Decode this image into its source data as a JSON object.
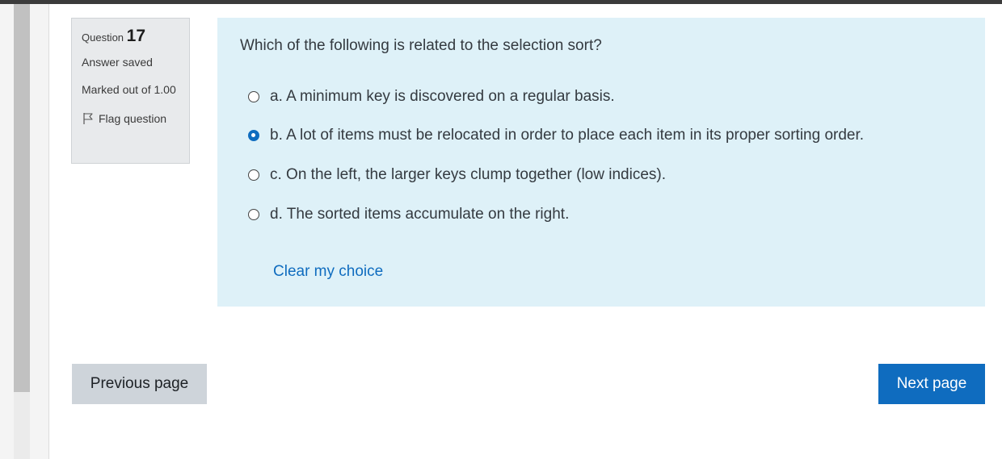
{
  "question": {
    "label": "Question",
    "number": "17",
    "state": "Answer saved",
    "grade": "Marked out of 1.00",
    "flag_label": "Flag question",
    "text": "Which of the following is related to the selection sort?",
    "answers": [
      {
        "text": "a. A minimum key is discovered on a regular basis.",
        "selected": false
      },
      {
        "text": "b. A lot of items must be relocated in order to place each item in its proper sorting order.",
        "selected": true
      },
      {
        "text": "c. On the left, the larger keys clump together (low indices).",
        "selected": false
      },
      {
        "text": "d. The sorted items accumulate on the right.",
        "selected": false
      }
    ],
    "clear_label": "Clear my choice"
  },
  "navigation": {
    "prev_label": "Previous page",
    "next_label": "Next page"
  },
  "colors": {
    "accent": "#0f6cbf",
    "content_bg": "#def1f8",
    "info_bg": "#e8eaec"
  },
  "icons": {
    "flag": "flag-icon"
  }
}
